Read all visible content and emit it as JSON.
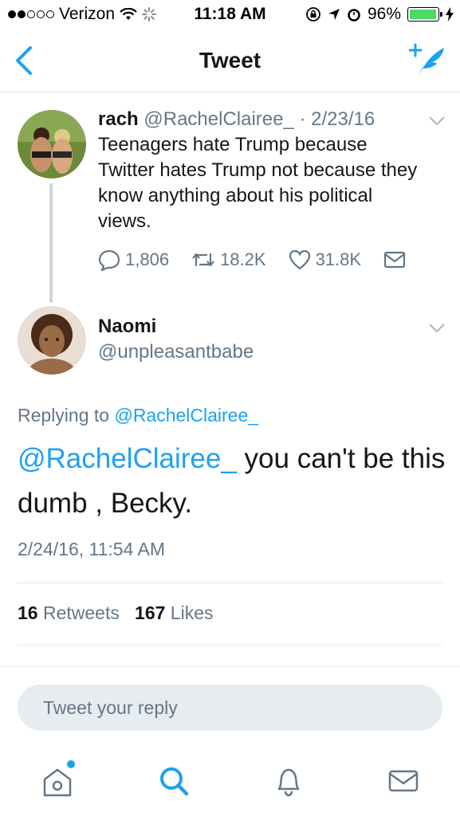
{
  "status_bar": {
    "carrier": "Verizon",
    "time": "11:18 AM",
    "battery": "96%",
    "battery_level": 0.96
  },
  "nav": {
    "title": "Tweet",
    "back_icon": "chevron-left-icon",
    "compose_icon": "compose-tweet-icon"
  },
  "parent_tweet": {
    "name": "rach",
    "handle": "@RachelClairee_",
    "date": "· 2/23/16",
    "text": "Teenagers hate Trump because Twitter hates Trump not because they know anything about his political views.",
    "replies": "1,806",
    "retweets": "18.2K",
    "likes": "31.8K"
  },
  "reply_tweet": {
    "name": "Naomi",
    "handle": "@unpleasantbabe",
    "replying_prefix": "Replying to",
    "replying_to": "@RachelClairee_",
    "mention": "@RachelClairee_",
    "text": " you can't be this dumb , Becky.",
    "datetime": "2/24/16, 11:54 AM",
    "retweet_count": "16",
    "retweet_label": "Retweets",
    "like_count": "167",
    "like_label": "Likes"
  },
  "composer": {
    "placeholder": "Tweet your reply"
  },
  "tab_bar": {
    "items": [
      "home-icon",
      "search-icon",
      "notifications-icon",
      "messages-icon"
    ],
    "accent": "#1da1f2"
  },
  "colors": {
    "accent": "#1da1f2",
    "secondary_text": "#657786",
    "primary_text": "#14171a"
  }
}
